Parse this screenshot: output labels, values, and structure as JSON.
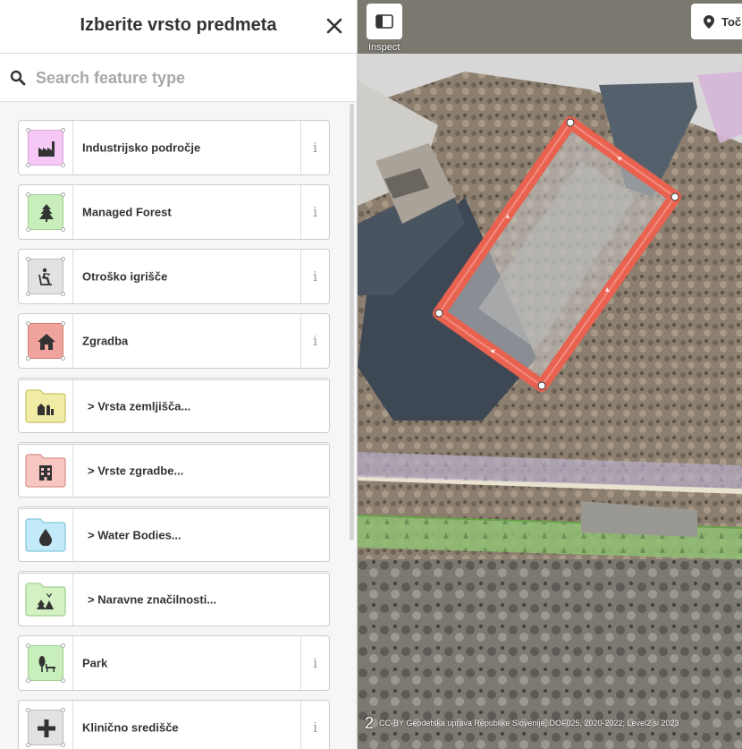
{
  "sidebar": {
    "title": "Izberite vrsto predmeta",
    "search_placeholder": "Search feature type",
    "items": [
      {
        "label": "Industrijsko področje",
        "icon": "factory-icon",
        "color": "#f5c8f5",
        "type": "preset"
      },
      {
        "label": "Managed Forest",
        "icon": "tree-icon",
        "color": "#c8eebc",
        "type": "preset"
      },
      {
        "label": "Otroško igrišče",
        "icon": "playground-icon",
        "color": "#e2e2e2",
        "type": "preset"
      },
      {
        "label": "Zgradba",
        "icon": "house-icon",
        "color": "#f0a39c",
        "type": "preset"
      },
      {
        "label": "Vrsta zemljišča...",
        "icon": "landuse-icon",
        "color": "#f0eca6",
        "type": "category"
      },
      {
        "label": "Vrste zgradbe...",
        "icon": "building-icon",
        "color": "#f7c6c1",
        "type": "category"
      },
      {
        "label": "Water Bodies...",
        "icon": "water-drop-icon",
        "color": "#c2eaf8",
        "type": "category"
      },
      {
        "label": "Naravne značilnosti...",
        "icon": "natural-icon",
        "color": "#d3f1c2",
        "type": "category"
      },
      {
        "label": "Park",
        "icon": "park-icon",
        "color": "#c8eebc",
        "type": "preset"
      },
      {
        "label": "Klinično središče",
        "icon": "plus-icon",
        "color": "#e2e2e2",
        "type": "preset"
      }
    ],
    "info_symbol": "i",
    "category_chevron": ">"
  },
  "map": {
    "inspect_label": "Inspect",
    "point_label": "Točka",
    "attribution_number": "2",
    "attribution": "CC-BY Geodetska uprava Republike Slovenije, DOF025, 2020-2022; Level2.si 2023",
    "selection_color": "#e8624f"
  }
}
